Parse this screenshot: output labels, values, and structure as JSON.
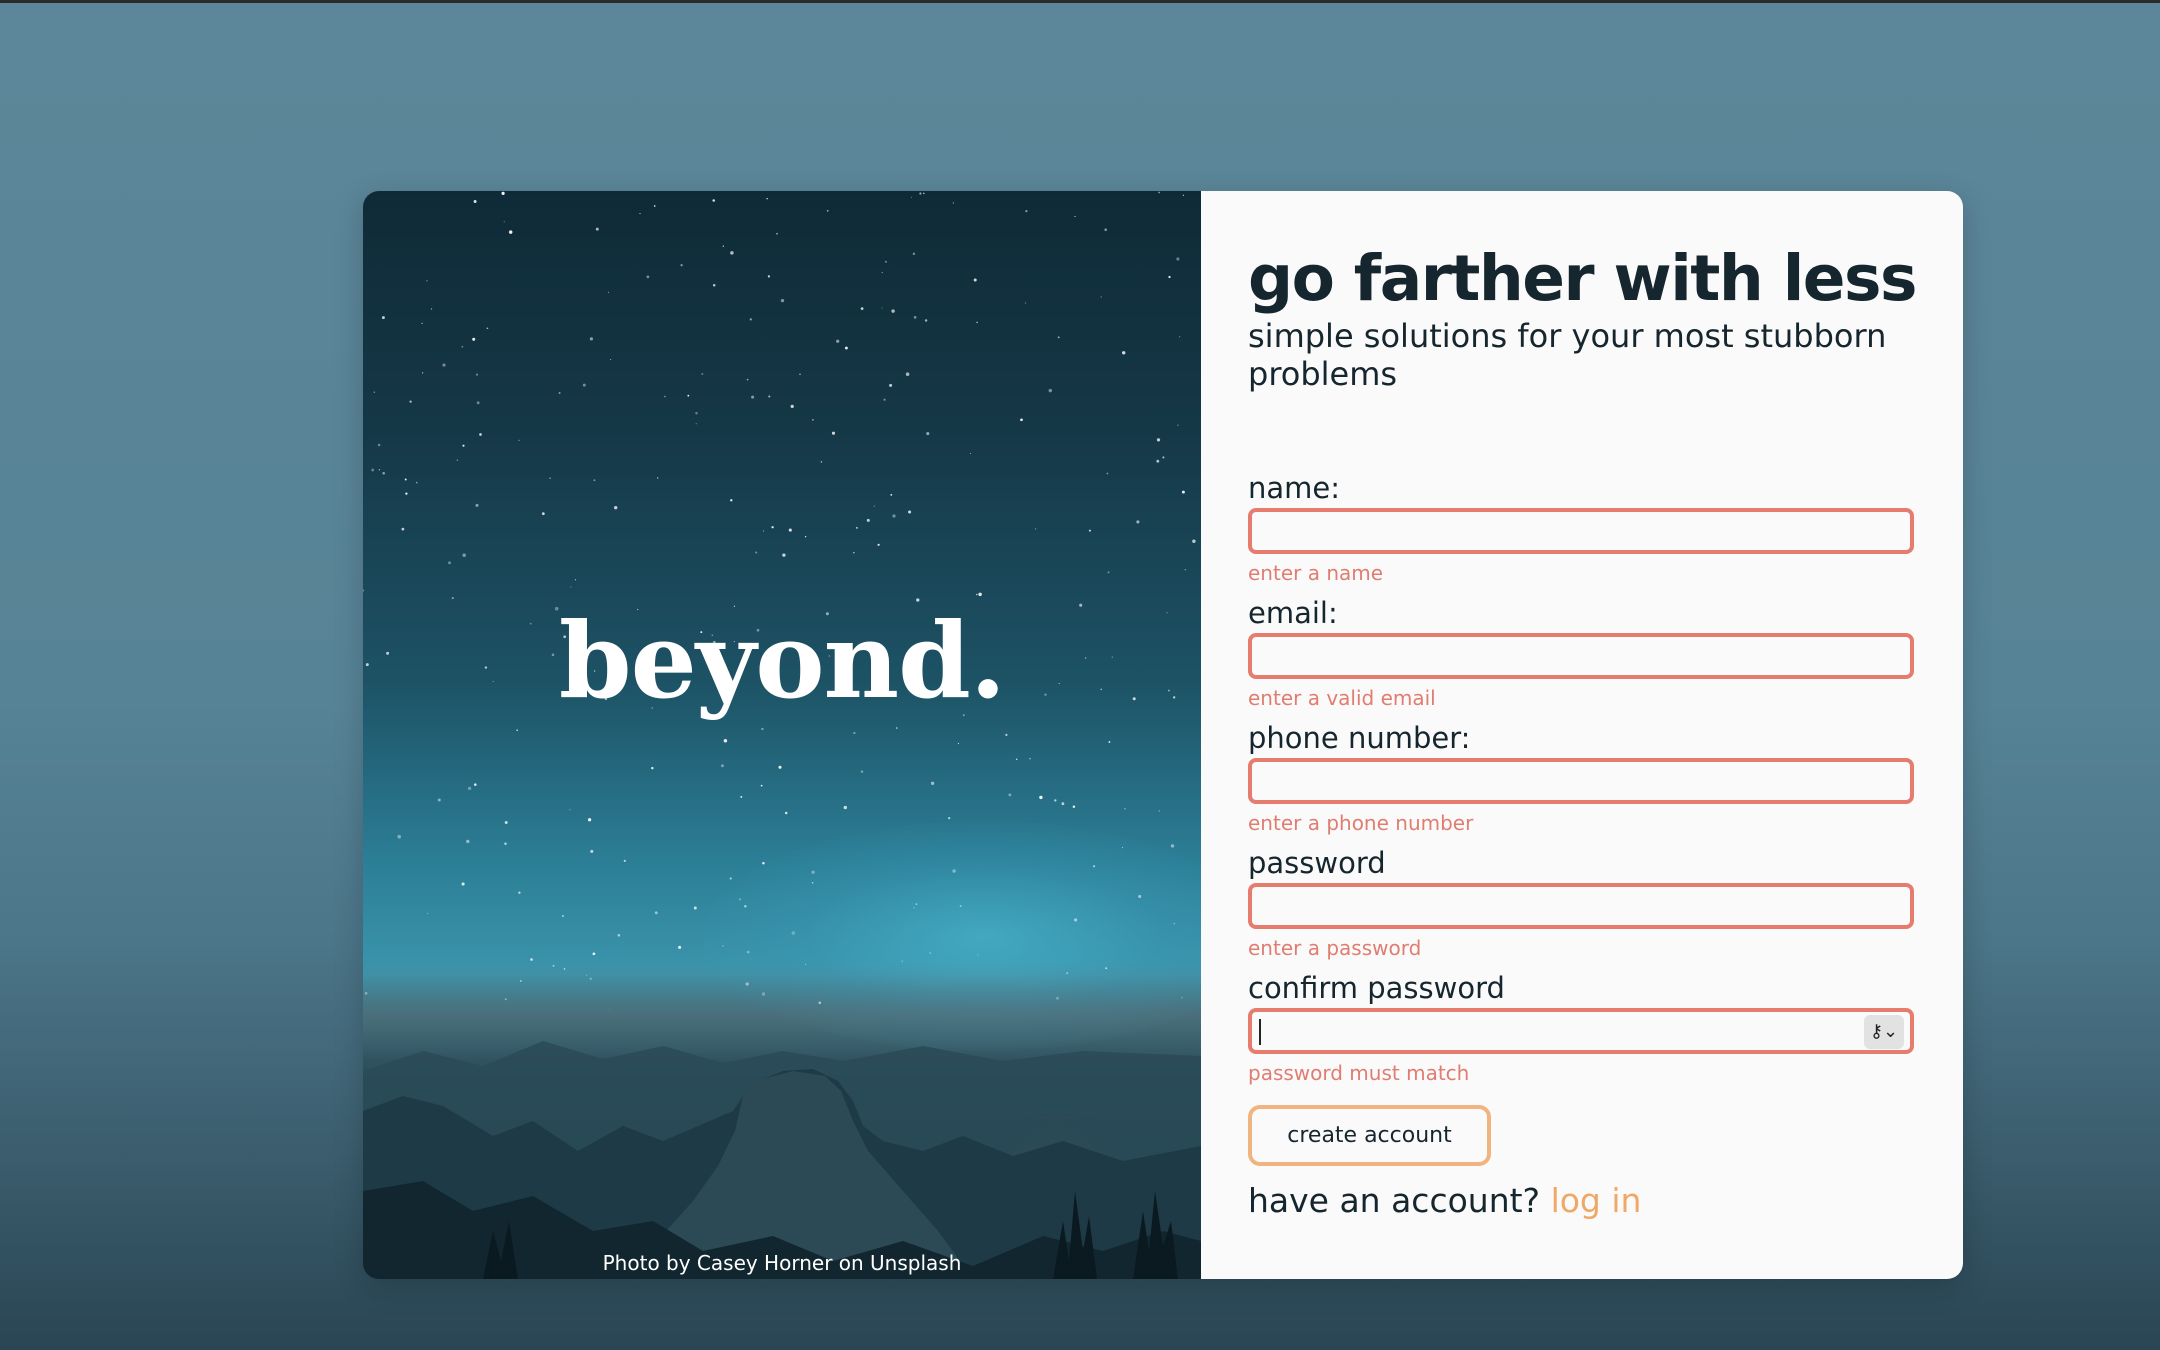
{
  "hero": {
    "logo": "beyond.",
    "credit": "Photo by Casey Horner on Unsplash"
  },
  "form": {
    "headline": "go farther with less",
    "subheadline": "simple solutions for your most stubborn problems",
    "fields": [
      {
        "label": "name:",
        "value": "",
        "error": "enter a name"
      },
      {
        "label": "email:",
        "value": "",
        "error": "enter a valid email"
      },
      {
        "label": "phone number:",
        "value": "",
        "error": "enter a phone number"
      },
      {
        "label": "password",
        "value": "",
        "error": "enter a password"
      },
      {
        "label": "confirm password",
        "value": "",
        "error": "password must match"
      }
    ],
    "submit_label": "create account",
    "have_account_text": "have an account?",
    "login_link": "log in"
  },
  "icons": {
    "password_manager": "key-icon"
  },
  "colors": {
    "error": "#e67c6e",
    "accent": "#f0a866",
    "text": "#16262e"
  }
}
